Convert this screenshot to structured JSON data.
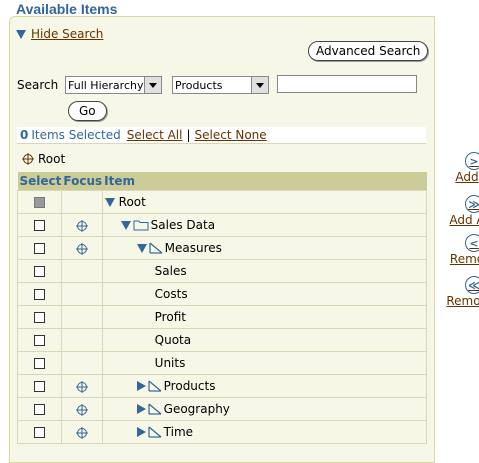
{
  "title": "Available Items",
  "hide_search": "Hide Search",
  "advanced_search": "Advanced Search",
  "search": {
    "label": "Search",
    "scope_value": "Full Hierarchy",
    "dimension_value": "Products",
    "text_value": "",
    "go_label": "Go"
  },
  "selection": {
    "count": "0",
    "items_selected": "Items Selected",
    "select_all": "Select All",
    "separator": "|",
    "select_none": "Select None"
  },
  "breadcrumb": {
    "root": "Root"
  },
  "columns": {
    "select": "Select",
    "focus": "Focus",
    "item": "Item"
  },
  "rows": [
    {
      "label": "Root",
      "checkbox": "disabled",
      "focus": false,
      "indent": 0,
      "expander": "down",
      "icon": "none"
    },
    {
      "label": "Sales Data",
      "checkbox": "enabled",
      "focus": true,
      "indent": 1,
      "expander": "down",
      "icon": "folder"
    },
    {
      "label": "Measures",
      "checkbox": "enabled",
      "focus": true,
      "indent": 2,
      "expander": "down",
      "icon": "dimension"
    },
    {
      "label": "Sales",
      "checkbox": "enabled",
      "focus": false,
      "indent": 3,
      "expander": "none",
      "icon": "none"
    },
    {
      "label": "Costs",
      "checkbox": "enabled",
      "focus": false,
      "indent": 3,
      "expander": "none",
      "icon": "none"
    },
    {
      "label": "Profit",
      "checkbox": "enabled",
      "focus": false,
      "indent": 3,
      "expander": "none",
      "icon": "none"
    },
    {
      "label": "Quota",
      "checkbox": "enabled",
      "focus": false,
      "indent": 3,
      "expander": "none",
      "icon": "none"
    },
    {
      "label": "Units",
      "checkbox": "enabled",
      "focus": false,
      "indent": 3,
      "expander": "none",
      "icon": "none"
    },
    {
      "label": "Products",
      "checkbox": "enabled",
      "focus": true,
      "indent": 2,
      "expander": "right",
      "icon": "dimension"
    },
    {
      "label": "Geography",
      "checkbox": "enabled",
      "focus": true,
      "indent": 2,
      "expander": "right",
      "icon": "dimension"
    },
    {
      "label": "Time",
      "checkbox": "enabled",
      "focus": true,
      "indent": 2,
      "expander": "right",
      "icon": "dimension"
    }
  ],
  "side_actions": [
    {
      "label": "Add",
      "glyph": ">"
    },
    {
      "label": "Add A",
      "glyph": "≫"
    },
    {
      "label": "Remo",
      "glyph": "<"
    },
    {
      "label": "Remov",
      "glyph": "≪"
    }
  ],
  "colors": {
    "accent": "#336699",
    "panel": "#f7f7e7",
    "header": "#cccc99",
    "link": "#663300"
  }
}
